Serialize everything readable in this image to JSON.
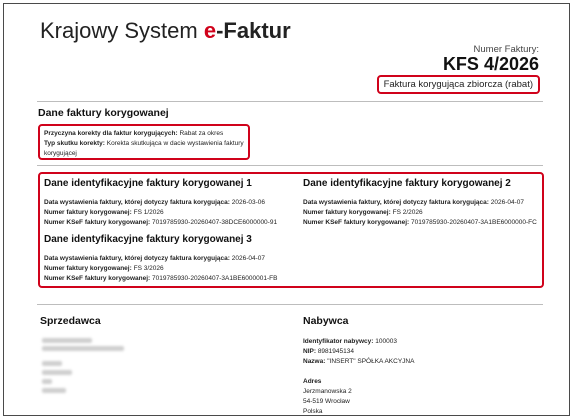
{
  "header": {
    "title_part1": "Krajowy System ",
    "title_e": "e",
    "title_part2": "-Faktur",
    "invoice_number_label": "Numer Faktury:",
    "invoice_number": "KFS 4/2026",
    "invoice_type": "Faktura korygująca zbiorcza (rabat)"
  },
  "corrected_invoice_data": {
    "heading": "Dane faktury korygowanej",
    "reason_label": "Przyczyna korekty dla faktur korygujących:",
    "reason_value": "Rabat za okres",
    "effect_label": "Typ skutku korekty:",
    "effect_value": "Korekta skutkująca w dacie wystawienia faktury korygującej"
  },
  "corrected_invoices": [
    {
      "heading": "Dane identyfikacyjne faktury korygowanej 1",
      "date_label": "Data wystawienia faktury, której dotyczy faktura korygująca:",
      "date_value": "2026-03-06",
      "number_label": "Numer faktury korygowanej:",
      "number_value": "FS 1/2026",
      "ksef_label": "Numer KSeF faktury korygowanej:",
      "ksef_value": "7019785930-20260407-38DCE6000000-91"
    },
    {
      "heading": "Dane identyfikacyjne faktury korygowanej 2",
      "date_label": "Data wystawienia faktury, której dotyczy faktura korygująca:",
      "date_value": "2026-04-07",
      "number_label": "Numer faktury korygowanej:",
      "number_value": "FS 2/2026",
      "ksef_label": "Numer KSeF faktury korygowanej:",
      "ksef_value": "7019785930-20260407-3A1BE6000000-FC"
    },
    {
      "heading": "Dane identyfikacyjne faktury korygowanej 3",
      "date_label": "Data wystawienia faktury, której dotyczy faktura korygująca:",
      "date_value": "2026-04-07",
      "number_label": "Numer faktury korygowanej:",
      "number_value": "FS 3/2026",
      "ksef_label": "Numer KSeF faktury korygowanej:",
      "ksef_value": "7019785930-20260407-3A1BE6000001-FB"
    }
  ],
  "seller": {
    "heading": "Sprzedawca"
  },
  "buyer": {
    "heading": "Nabywca",
    "id_label": "Identyfikator nabywcy:",
    "id_value": "100003",
    "nip_label": "NIP:",
    "nip_value": "8981945134",
    "name_label": "Nazwa:",
    "name_value": "\"INSERT\" SPÓŁKA AKCYJNA",
    "address_label": "Adres",
    "address_line1": "Jerzmanowska 2",
    "address_line2": "54-519 Wrocław",
    "address_line3": "Polska"
  },
  "colors": {
    "accent_red": "#d0021b"
  }
}
